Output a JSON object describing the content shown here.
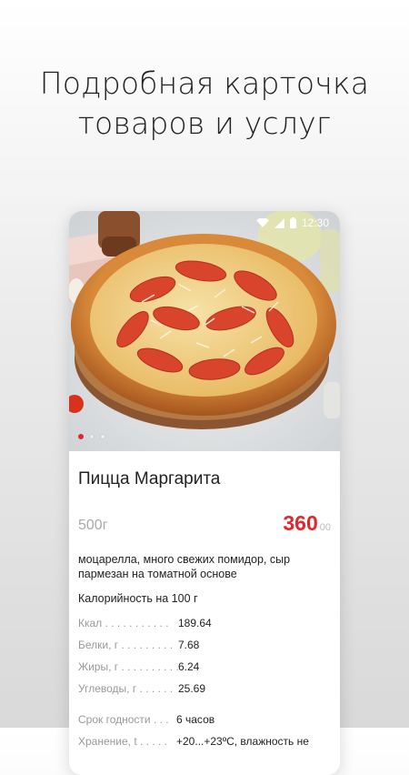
{
  "headline": {
    "line1": "Подробная карточка",
    "line2": "товаров и услуг"
  },
  "status_bar": {
    "time": "12:30",
    "icons": [
      "wifi-icon",
      "signal-icon",
      "battery-icon"
    ]
  },
  "gallery": {
    "image": "pizza-margherita-photo",
    "dots_count": 3,
    "active_dot": 1
  },
  "product": {
    "title": "Пицца Маргарита",
    "weight": "500г",
    "price": "360",
    "price_cents": "00",
    "description": "моцарелла, много свежих помидор, сыр пармезан на томатной основе",
    "calories_title": "Калорийность на 100 г",
    "nutrition": [
      {
        "label": "Ккал . . . . . . . . . . .",
        "value": "189.64"
      },
      {
        "label": "Белки, г . . . . . . . . .",
        "value": "7.68"
      },
      {
        "label": "Жиры, г . . . . . . . . . .",
        "value": "6.24"
      },
      {
        "label": "Углеводы, г . . . . . .",
        "value": "25.69"
      }
    ],
    "storage": [
      {
        "label": "Срок годности . . .",
        "value": "6 часов"
      },
      {
        "label": "Хранение, t . . . . .",
        "value": "+20...+23ºС, влажность не"
      }
    ]
  },
  "colors": {
    "accent": "#e3262b",
    "muted": "#aaaaaa"
  }
}
